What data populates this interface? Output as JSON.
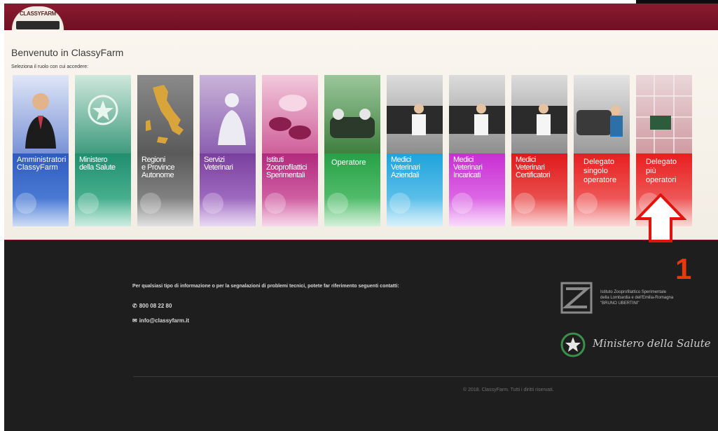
{
  "header": {
    "logo_text": "CLASSYFARM"
  },
  "page": {
    "title": "Benvenuto in ClassyFarm",
    "subtitle": "Seleziona il ruolo con cui accedere:"
  },
  "roles": [
    {
      "label": "Amministratori\nClassyFarm",
      "color": "#2f5bbf"
    },
    {
      "label": "Ministero\ndella Salute",
      "color": "#1f8f6e"
    },
    {
      "label": "Regioni\ne Province\nAutonome",
      "color": "#5a5a5a"
    },
    {
      "label": "Servizi\nVeterinari",
      "color": "#7a3f9e"
    },
    {
      "label": "Istituti\nZooprofilattici\nSperimentali",
      "color": "#b12a7e"
    },
    {
      "label": "Operatore",
      "color": "#27a047"
    },
    {
      "label": "Medici\nVeterinari\nAziendali",
      "color": "#1fa3dc"
    },
    {
      "label": "Medici\nVeterinari\nIncaricati",
      "color": "#c82fd2"
    },
    {
      "label": "Medici\nVeterinari\nCertificatori",
      "color": "#e01919"
    },
    {
      "label": "Delegato\nsingolo\noperatore",
      "color": "#e81e1e"
    },
    {
      "label": "Delegato\npiù\noperatori",
      "color": "#e81e1e"
    }
  ],
  "footer": {
    "info": "Per qualsiasi tipo di informazione o per la segnalazioni di problemi tecnici, potete far riferimento seguenti contatti:",
    "phone": "800 08 22 80",
    "email": "info@classyfarm.it",
    "izs_text": "Istituto Zooprofilattico Sperimentale\ndella Lombardia e dell'Emilia-Romagna\n\"BRUNO UBERTINI\"",
    "ministero": "Ministero della Salute",
    "copyright": "© 2018. ClassyFarm. Tutti i diritti riservati."
  },
  "annotation": {
    "step": "1",
    "color": "#e8380d"
  }
}
